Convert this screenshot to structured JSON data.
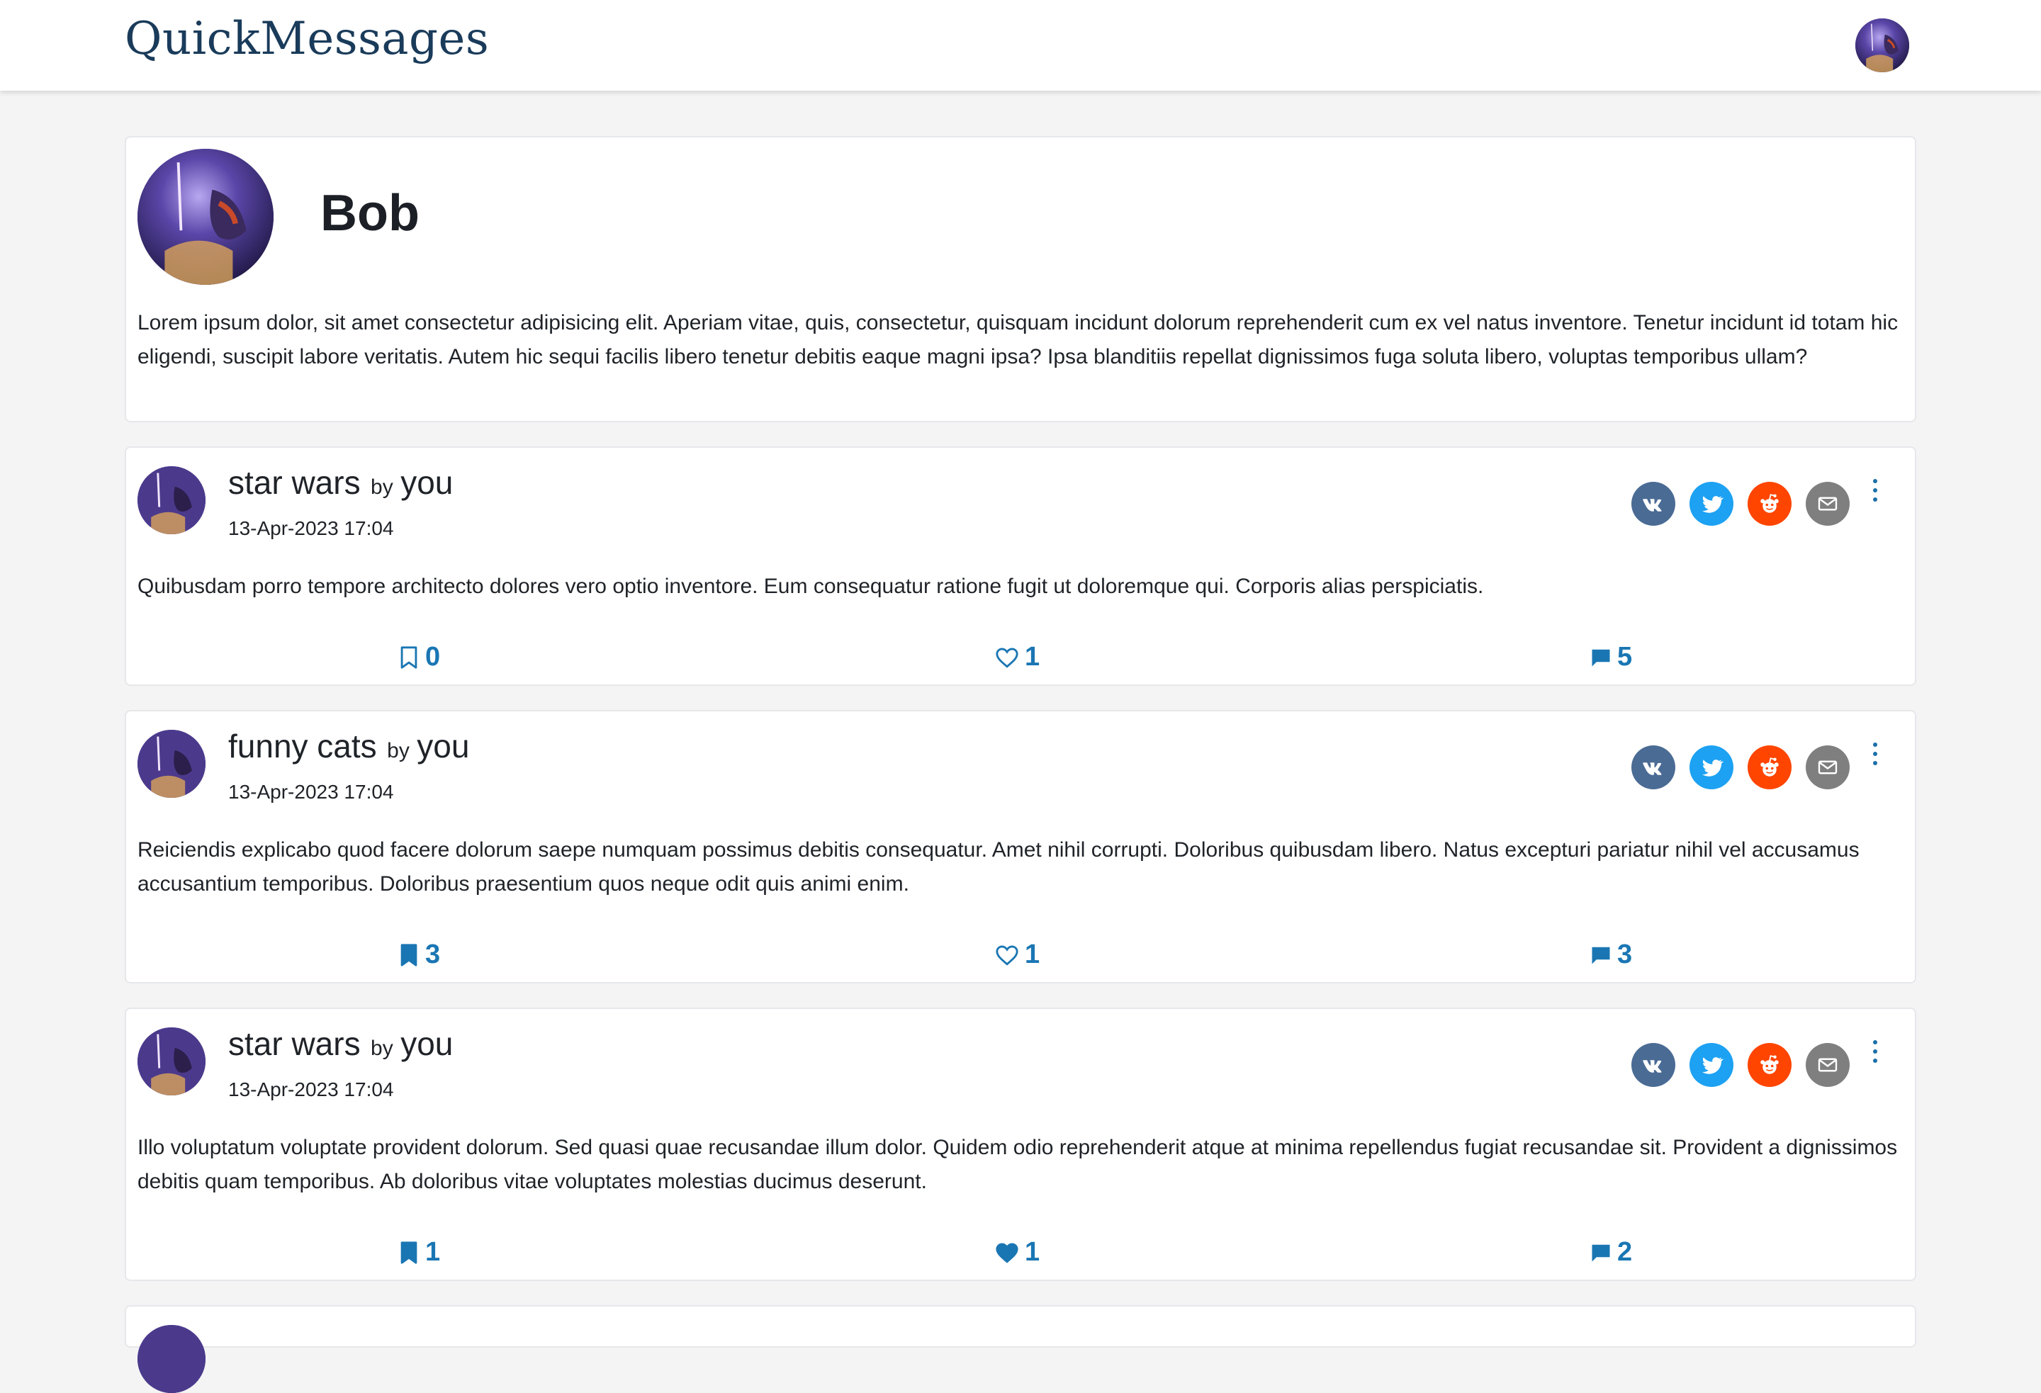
{
  "app": {
    "brand": "QuickMessages"
  },
  "header": {
    "avatar_icon": "user-avatar-icon"
  },
  "profile": {
    "name": "Bob",
    "bio": "Lorem ipsum dolor, sit amet consectetur adipisicing elit. Aperiam vitae, quis, consectetur, quisquam incidunt dolorum reprehenderit cum ex vel natus inventore. Tenetur incidunt id totam hic eligendi, suscipit labore veritatis. Autem hic sequi facilis libero tenetur debitis eaque magni ipsa? Ipsa blanditiis repellat dignissimos fuga soluta libero, voluptas temporibus ullam?"
  },
  "colors": {
    "brand": "#1a3b5a",
    "accent": "#1a76b3",
    "vk": "#4a6b94",
    "twitter": "#1da1f2",
    "reddit": "#ff4500",
    "mail": "#7f7f7f"
  },
  "posts": [
    {
      "title": "star wars",
      "by": "by",
      "author": "you",
      "date": "13-Apr-2023 17:04",
      "body": "Quibusdam porro tempore architecto dolores vero optio inventore. Eum consequatur ratione fugit ut doloremque qui. Corporis alias perspiciatis.",
      "bookmarks": "0",
      "bookmarked": false,
      "likes": "1",
      "liked": false,
      "comments": "5"
    },
    {
      "title": "funny cats",
      "by": "by",
      "author": "you",
      "date": "13-Apr-2023 17:04",
      "body": "Reiciendis explicabo quod facere dolorum saepe numquam possimus debitis consequatur. Amet nihil corrupti. Doloribus quibusdam libero. Natus excepturi pariatur nihil vel accusamus accusantium temporibus. Doloribus praesentium quos neque odit quis animi enim.",
      "bookmarks": "3",
      "bookmarked": true,
      "likes": "1",
      "liked": false,
      "comments": "3"
    },
    {
      "title": "star wars",
      "by": "by",
      "author": "you",
      "date": "13-Apr-2023 17:04",
      "body": "Illo voluptatum voluptate provident dolorum. Sed quasi quae recusandae illum dolor. Quidem odio reprehenderit atque at minima repellendus fugiat recusandae sit. Provident a dignissimos debitis quam temporibus. Ab doloribus vitae voluptates molestias ducimus deserunt.",
      "bookmarks": "1",
      "bookmarked": true,
      "likes": "1",
      "liked": true,
      "comments": "2"
    }
  ],
  "share_icons": [
    "vk-icon",
    "twitter-icon",
    "reddit-icon",
    "mail-icon"
  ]
}
